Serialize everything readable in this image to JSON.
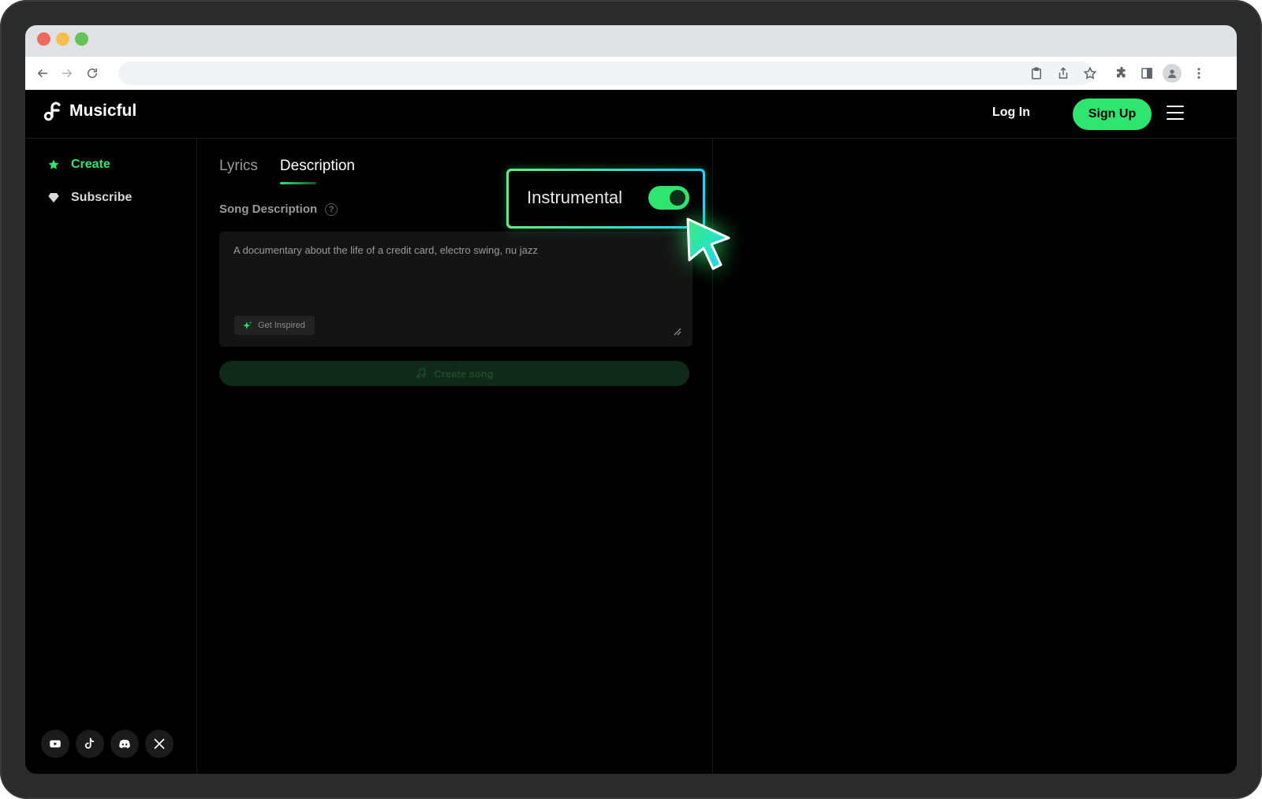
{
  "browser": {
    "address": ""
  },
  "app": {
    "brand": "Musicful",
    "header": {
      "login_label": "Log In",
      "signup_label": "Sign Up"
    },
    "sidebar": {
      "items": [
        {
          "label": "Create",
          "icon": "star-icon",
          "active": true
        },
        {
          "label": "Subscribe",
          "icon": "diamond-icon",
          "active": false
        }
      ],
      "socials": [
        "youtube-icon",
        "tiktok-icon",
        "discord-icon",
        "x-icon"
      ]
    },
    "tabs": [
      {
        "label": "Lyrics",
        "active": false
      },
      {
        "label": "Description",
        "active": true
      }
    ],
    "song_description": {
      "label": "Song Description",
      "help": "?",
      "value": "A documentary about the life of a credit card, electro swing, nu jazz",
      "get_inspired_label": "Get Inspired"
    },
    "create_button_label": "Create song",
    "instrumental": {
      "label": "Instrumental",
      "enabled": true
    }
  },
  "colors": {
    "accent": "#2ee56f",
    "background": "#000000",
    "highlight_border_start": "#5df07a",
    "highlight_border_end": "#1ad3ff"
  }
}
